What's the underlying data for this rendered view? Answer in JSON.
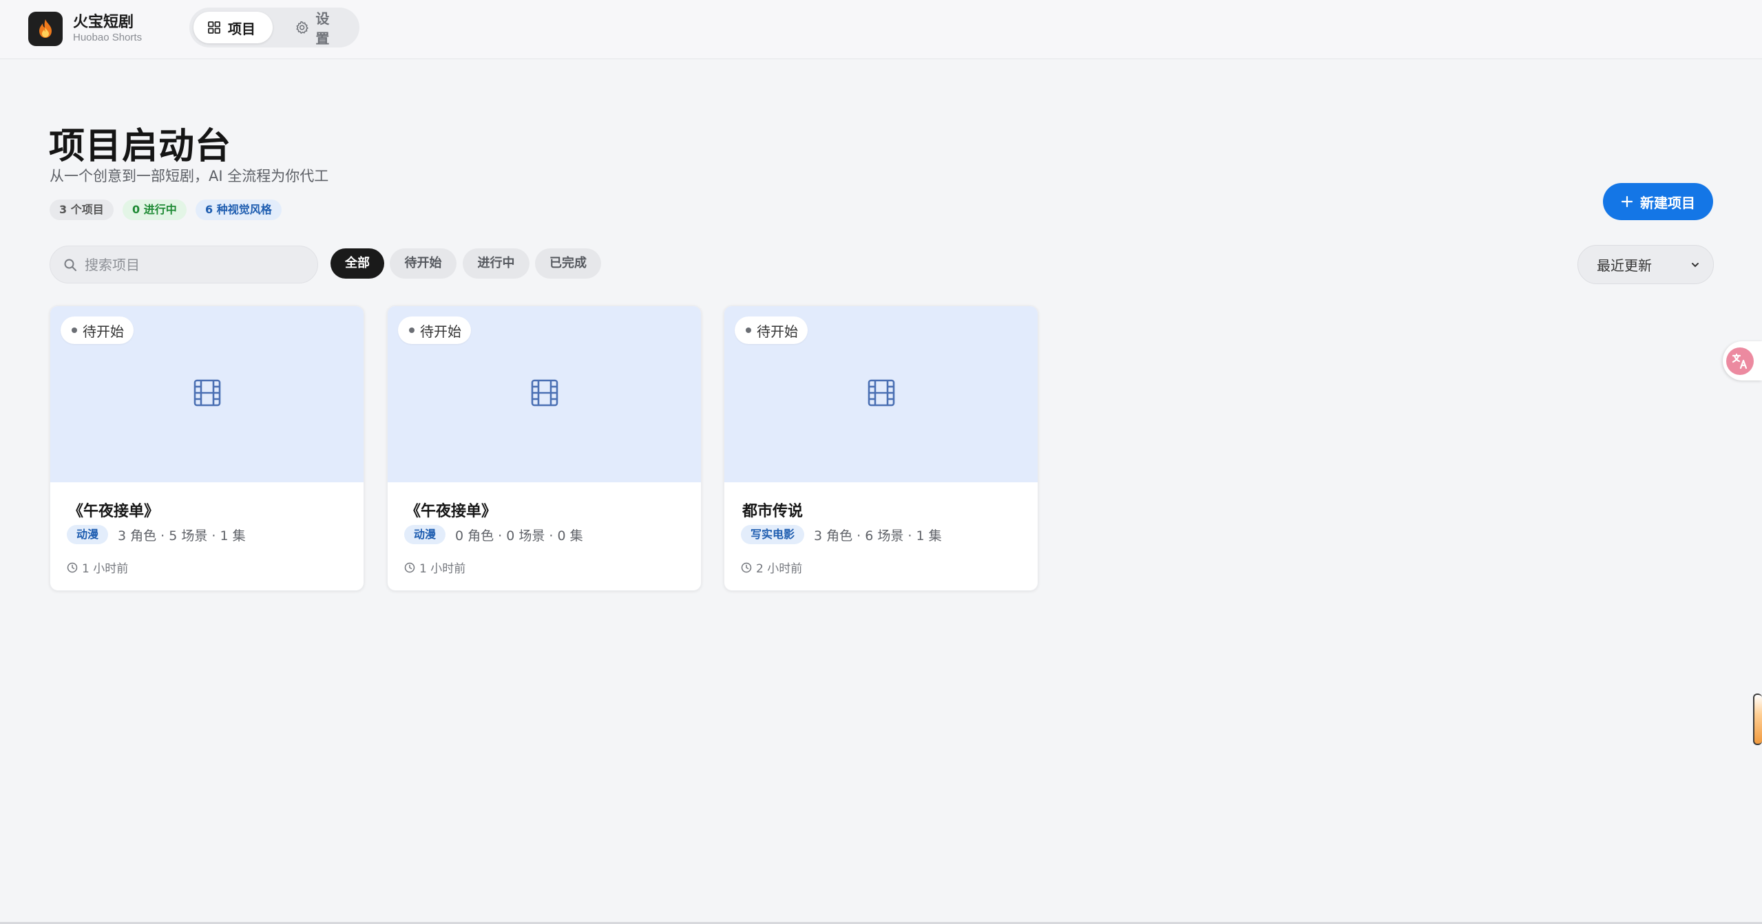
{
  "header": {
    "brand_title": "火宝短剧",
    "brand_subtitle": "Huobao Shorts",
    "nav": [
      {
        "label": "项目",
        "icon": "grid-icon",
        "active": true
      },
      {
        "label": "设置",
        "icon": "gear-icon",
        "active": false
      }
    ]
  },
  "page": {
    "title": "项目启动台",
    "subtitle": "从一个创意到一部短剧，AI 全流程为你代工",
    "stats": {
      "total": "3 个项目",
      "in_progress": "0 进行中",
      "styles": "6 种视觉风格"
    },
    "new_button": "新建项目"
  },
  "toolbar": {
    "search_placeholder": "搜索项目",
    "filters": [
      "全部",
      "待开始",
      "进行中",
      "已完成"
    ],
    "active_filter": "全部",
    "sort_selected": "最近更新"
  },
  "projects": [
    {
      "status": "待开始",
      "title": "《午夜接单》",
      "style": "动漫",
      "meta": "3 角色 · 5 场景 · 1 集",
      "updated": "1 小时前"
    },
    {
      "status": "待开始",
      "title": "《午夜接单》",
      "style": "动漫",
      "meta": "0 角色 · 0 场景 · 0 集",
      "updated": "1 小时前"
    },
    {
      "status": "待开始",
      "title": "都市传说",
      "style": "写实电影",
      "meta": "3 角色 · 6 场景 · 1 集",
      "updated": "2 小时前"
    }
  ],
  "colors": {
    "accent": "#1476e6",
    "cover_bg": "#e2ebfc",
    "progress_green": "#1e8a34",
    "style_blue": "#1e5db0"
  }
}
